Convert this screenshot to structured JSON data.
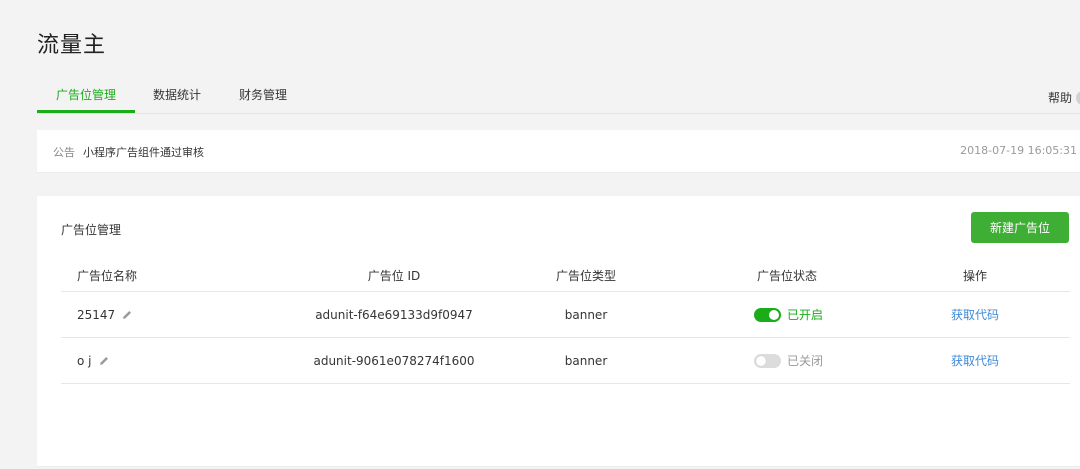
{
  "page_title": "流量主",
  "tabs": [
    {
      "label": "广告位管理",
      "active": true
    },
    {
      "label": "数据统计",
      "active": false
    },
    {
      "label": "财务管理",
      "active": false
    }
  ],
  "help_label": "帮助",
  "notice": {
    "label": "公告",
    "text": "小程序广告组件通过审核",
    "time": "2018-07-19 16:05:31"
  },
  "card": {
    "title": "广告位管理",
    "new_button": "新建广告位"
  },
  "table": {
    "headers": [
      "广告位名称",
      "广告位 ID",
      "广告位类型",
      "广告位状态",
      "操作"
    ],
    "rows": [
      {
        "name": "25147",
        "id": "adunit-f64e69133d9f0947",
        "type": "banner",
        "status": "已开启",
        "enabled": true,
        "action": "获取代码"
      },
      {
        "name": "o j",
        "id": "adunit-9061e078274f1600",
        "type": "banner",
        "status": "已关闭",
        "enabled": false,
        "action": "获取代码"
      }
    ]
  },
  "colors": {
    "accent": "#1aad19",
    "button": "#3fae35",
    "link": "#3e8ad8"
  },
  "icons": {
    "edit": "pencil-icon",
    "help": "help-icon"
  }
}
